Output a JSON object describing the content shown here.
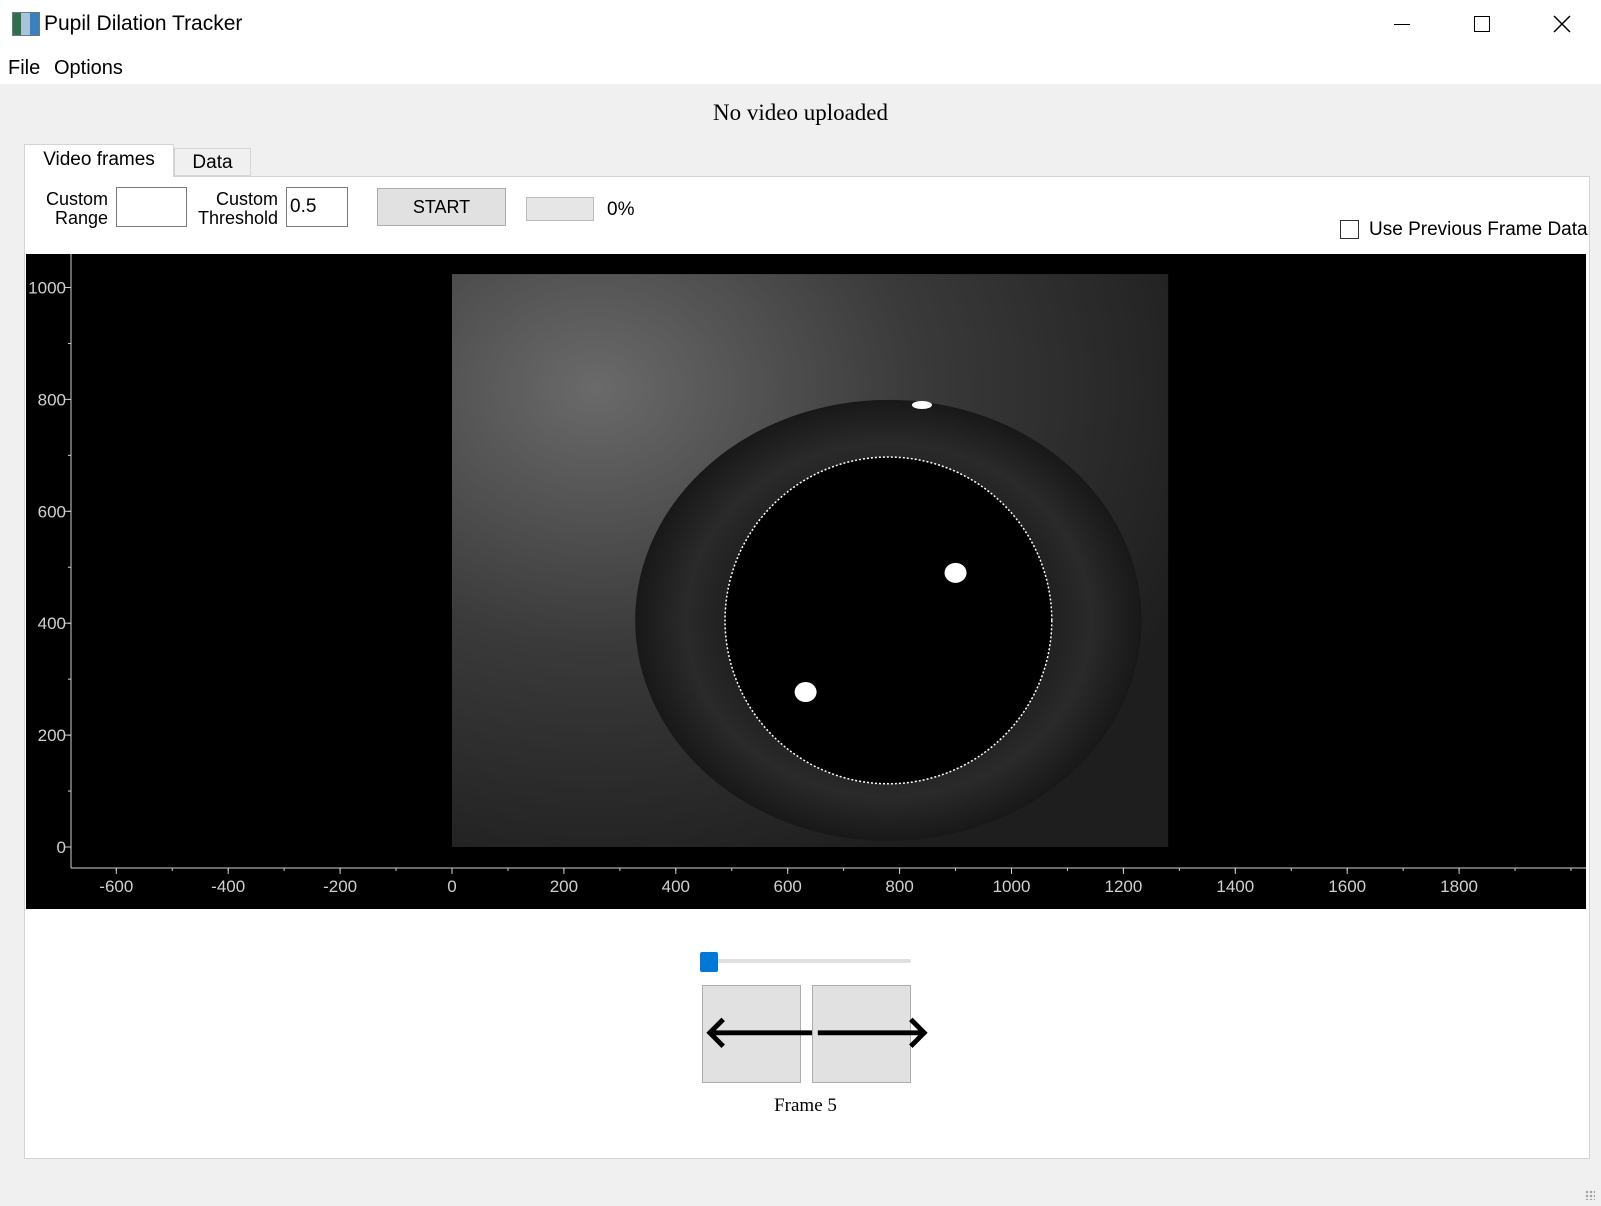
{
  "window": {
    "title": "Pupil Dilation Tracker"
  },
  "menu": [
    "File",
    "Options"
  ],
  "status_text": "No video uploaded",
  "tabs": [
    {
      "label": "Video frames",
      "active": true
    },
    {
      "label": "Data",
      "active": false
    }
  ],
  "controls": {
    "custom_range_label_1": "Custom",
    "custom_range_label_2": "Range",
    "custom_range_value": "",
    "custom_threshold_label_1": "Custom",
    "custom_threshold_label_2": "Threshold",
    "custom_threshold_value": "0.5",
    "start_label": "START",
    "progress_percent": 0,
    "progress_text": "0%",
    "use_previous_label": "Use Previous Frame Data",
    "use_previous_checked": false
  },
  "plot": {
    "x_ticks": [
      -600,
      -400,
      -200,
      0,
      200,
      400,
      600,
      800,
      1000,
      1200,
      1400,
      1600,
      1800
    ],
    "y_ticks": [
      0,
      200,
      400,
      600,
      800,
      1000
    ],
    "image_extent": {
      "x": [
        0,
        1280
      ],
      "y": [
        0,
        1024
      ]
    },
    "pupil_circle": {
      "cx": 780,
      "cy": 405,
      "r": 292
    },
    "glints": [
      {
        "x": 900,
        "y": 490
      },
      {
        "x": 632,
        "y": 277
      },
      {
        "x": 840,
        "y": 790
      }
    ],
    "colors": {
      "background": "#000000",
      "axis": "#d0d0d0",
      "circle": "#ffffff"
    }
  },
  "navigation": {
    "slider_value": 5,
    "prev_icon": "arrow-left-icon",
    "next_icon": "arrow-right-icon",
    "prev_glyph": "🡐",
    "next_glyph": "🡒",
    "frame_label": "Frame 5"
  }
}
